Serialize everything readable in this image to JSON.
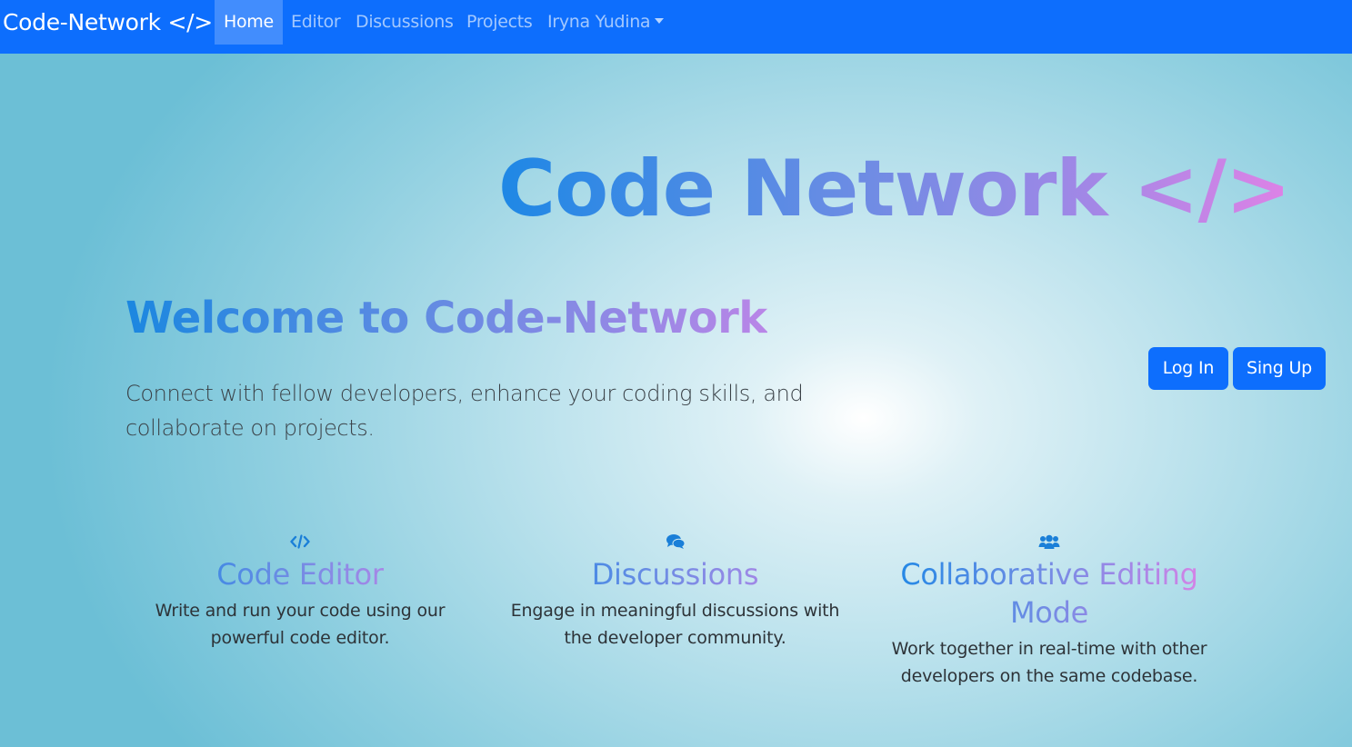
{
  "navbar": {
    "brand": "Code-Network </>",
    "items": [
      {
        "label": "Home",
        "active": true
      },
      {
        "label": "Editor",
        "active": false
      },
      {
        "label": "Discussions",
        "active": false
      },
      {
        "label": "Projects",
        "active": false
      }
    ],
    "user": {
      "label": "Iryna Yudina",
      "icon": "caret-down-icon"
    }
  },
  "hero": {
    "title": "Code Network </>",
    "welcome": "Welcome to Code-Network",
    "lead": "Connect with fellow developers, enhance your coding skills, and collaborate on projects."
  },
  "auth": {
    "login_label": "Log In",
    "signup_label": "Sing Up"
  },
  "features": [
    {
      "icon": "code-icon",
      "title": "Code Editor",
      "text": "Write and run your code using our powerful code editor."
    },
    {
      "icon": "comments-icon",
      "title": "Discussions",
      "text": "Engage in meaningful discussions with the developer community."
    },
    {
      "icon": "users-icon",
      "title": "Collaborative Editing Mode",
      "text": "Work together in real-time with other developers on the same codebase."
    }
  ],
  "colors": {
    "primary": "#0d6efd",
    "gradient_start": "#1e88e5",
    "gradient_end": "#de82e6",
    "icon_blue": "#1a7fd8"
  }
}
